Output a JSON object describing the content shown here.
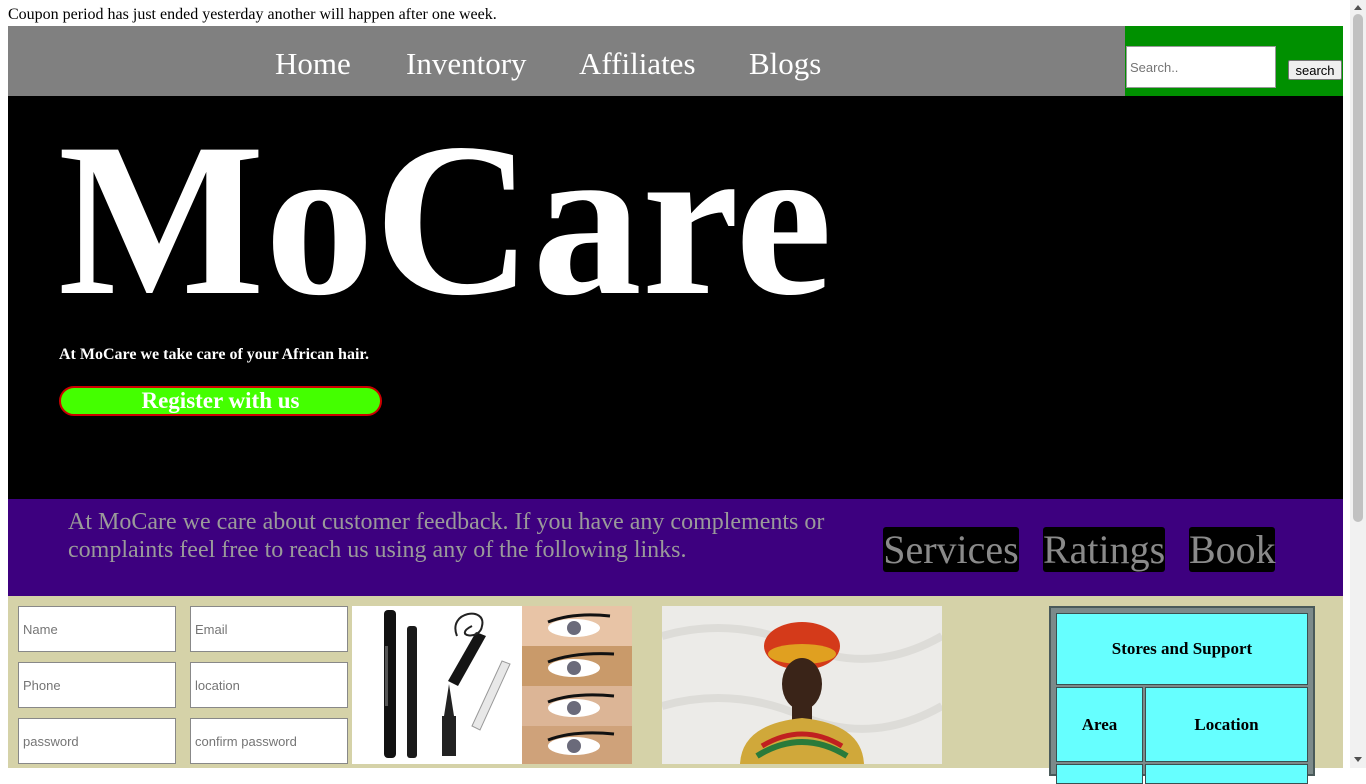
{
  "notice": "Coupon period has just ended yesterday another will happen after one week.",
  "nav": {
    "items": [
      {
        "label": "Home"
      },
      {
        "label": "Inventory"
      },
      {
        "label": "Affiliates"
      },
      {
        "label": "Blogs"
      }
    ]
  },
  "search": {
    "placeholder": "Search..",
    "button_label": "search"
  },
  "hero": {
    "title": "MoCare",
    "tagline": "At MoCare we take care of your African hair.",
    "register_label": "Register with us"
  },
  "feedback": {
    "text": "At MoCare we care about customer feedback. If you have any complements or complaints feel free to reach us using any of the following links.",
    "links": [
      {
        "label": "Services"
      },
      {
        "label": "Ratings"
      },
      {
        "label": "Book"
      }
    ]
  },
  "form": {
    "name_placeholder": "Name",
    "email_placeholder": "Email",
    "phone_placeholder": "Phone",
    "location_placeholder": "location",
    "password_placeholder": "password",
    "confirm_placeholder": "confirm password"
  },
  "stores": {
    "title": "Stores and Support",
    "col_area": "Area",
    "col_location": "Location"
  },
  "colors": {
    "nav_bg": "#808080",
    "search_bg": "#009000",
    "hero_bg": "#000000",
    "register_bg": "#44ff00",
    "register_border": "#cc0000",
    "feedback_bg": "#3d007f",
    "lower_bg": "#d5d2a8",
    "table_cell": "#66ffff"
  }
}
